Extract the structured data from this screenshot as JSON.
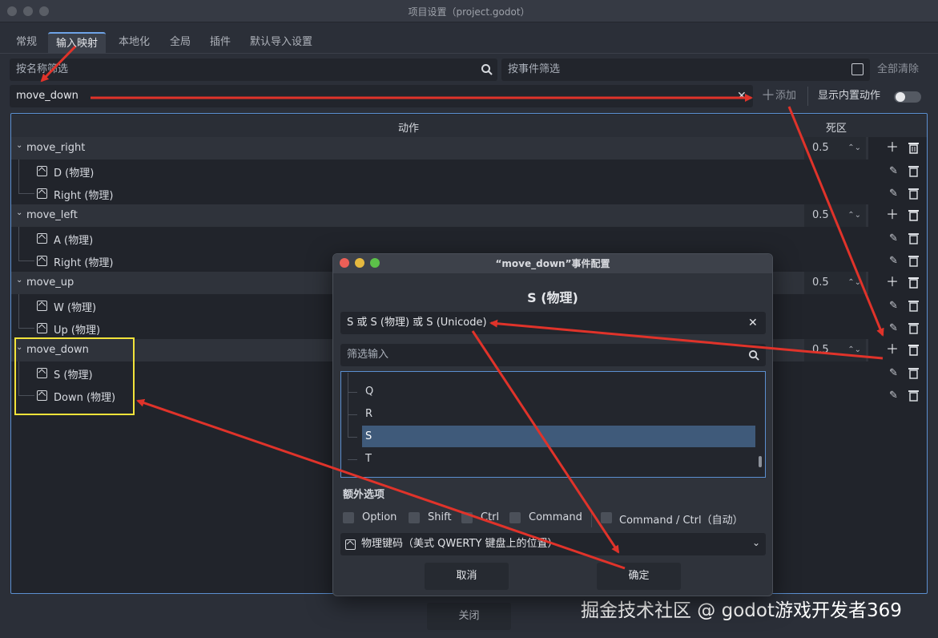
{
  "window": {
    "title": "项目设置（project.godot）"
  },
  "tabs": [
    "常规",
    "输入映射",
    "本地化",
    "全局",
    "插件",
    "默认导入设置"
  ],
  "filter": {
    "name_placeholder": "按名称筛选",
    "event_placeholder": "按事件筛选",
    "clear_all": "全部清除"
  },
  "new_action": {
    "value": "move_down",
    "add_label": "添加",
    "builtin_label": "显示内置动作"
  },
  "table": {
    "col_action": "动作",
    "col_deadzone": "死区"
  },
  "actions": [
    {
      "name": "move_right",
      "deadzone": "0.5",
      "events": [
        "D (物理)",
        "Right (物理)"
      ]
    },
    {
      "name": "move_left",
      "deadzone": "0.5",
      "events": [
        "A (物理)",
        "Right (物理)"
      ]
    },
    {
      "name": "move_up",
      "deadzone": "0.5",
      "events": [
        "W (物理)",
        "Up (物理)"
      ]
    },
    {
      "name": "move_down",
      "deadzone": "0.5",
      "events": [
        "S (物理)",
        "Down (物理)"
      ]
    }
  ],
  "dialog": {
    "title": "“move_down”事件配置",
    "heading": "S (物理)",
    "event_text": "S 或 S (物理) 或 S (Unicode)",
    "filter_placeholder": "筛选输入",
    "list_items": [
      "Q",
      "R",
      "S",
      "T"
    ],
    "selected_item": "S",
    "extra_label": "额外选项",
    "modifiers": [
      "Option",
      "Shift",
      "Ctrl",
      "Command",
      "Command / Ctrl（自动）"
    ],
    "keycode_select": "物理键码（美式 QWERTY 键盘上的位置）",
    "cancel": "取消",
    "ok": "确定"
  },
  "footer": {
    "close": "关闭"
  },
  "watermark": "掘金技术社区 @ godot游戏开发者369",
  "colors": {
    "accent": "#5b8fd0",
    "highlight": "#f2e33a",
    "arrow": "#e0332a"
  }
}
